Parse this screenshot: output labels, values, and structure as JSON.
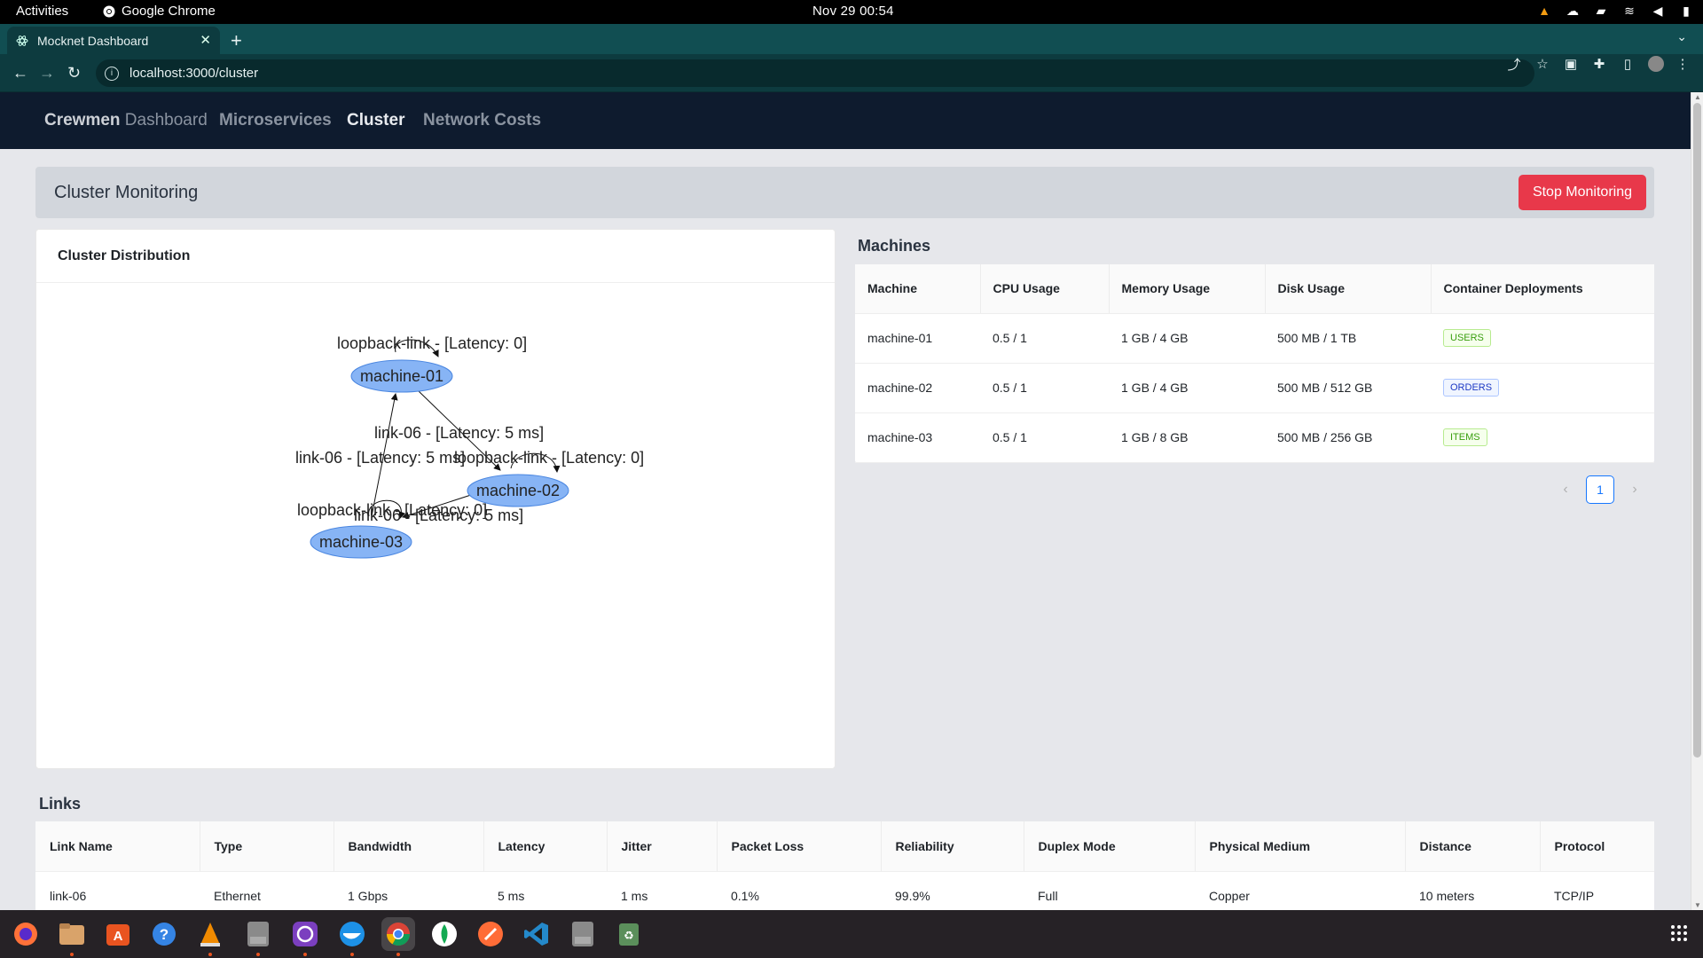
{
  "system_bar": {
    "activities": "Activities",
    "app_name": "Google Chrome",
    "clock": "Nov 29  00:54"
  },
  "browser": {
    "tab_title": "Mocknet Dashboard",
    "url": "localhost:3000/cluster"
  },
  "app_nav": {
    "brand_bold": "Crewmen",
    "brand_rest": " Dashboard",
    "links": [
      "Microservices",
      "Cluster",
      "Network Costs"
    ],
    "active": "Cluster"
  },
  "header": {
    "title": "Cluster Monitoring",
    "stop_button": "Stop Monitoring"
  },
  "distribution": {
    "title": "Cluster Distribution",
    "nodes": [
      "machine-01",
      "machine-02",
      "machine-03"
    ],
    "edge_labels": [
      "loopback-link - [Latency: 0]",
      "link-06 - [Latency: 5 ms]",
      "link-06 - [Latency: 5 ms]",
      "loopback-link - [Latency: 0]",
      "loopback-link - [Latency: 0]",
      "link-06 - [Latency: 5 ms]"
    ]
  },
  "machines": {
    "title": "Machines",
    "columns": [
      "Machine",
      "CPU Usage",
      "Memory Usage",
      "Disk Usage",
      "Container Deployments"
    ],
    "rows": [
      {
        "machine": "machine-01",
        "cpu": "0.5 / 1",
        "memory": "1 GB / 4 GB",
        "disk": "500 MB / 1 TB",
        "deployment": "USERS",
        "tag_color": "#389e0d"
      },
      {
        "machine": "machine-02",
        "cpu": "0.5 / 1",
        "memory": "1 GB / 4 GB",
        "disk": "500 MB / 512 GB",
        "deployment": "ORDERS",
        "tag_color": "#1d39c4"
      },
      {
        "machine": "machine-03",
        "cpu": "0.5 / 1",
        "memory": "1 GB / 8 GB",
        "disk": "500 MB / 256 GB",
        "deployment": "ITEMS",
        "tag_color": "#389e0d"
      }
    ],
    "current_page": "1"
  },
  "links": {
    "title": "Links",
    "columns": [
      "Link Name",
      "Type",
      "Bandwidth",
      "Latency",
      "Jitter",
      "Packet Loss",
      "Reliability",
      "Duplex Mode",
      "Physical Medium",
      "Distance",
      "Protocol"
    ],
    "rows": [
      [
        "link-06",
        "Ethernet",
        "1 Gbps",
        "5 ms",
        "1 ms",
        "0.1%",
        "99.9%",
        "Full",
        "Copper",
        "10 meters",
        "TCP/IP"
      ]
    ]
  },
  "dock": {
    "apps": [
      "firefox-icon",
      "files-icon",
      "app-center-icon",
      "help-icon",
      "vlc-icon",
      "disk-icon",
      "github-desktop-icon",
      "docker-icon",
      "chrome-icon",
      "mongodb-compass-icon",
      "postman-icon",
      "vscode-icon",
      "disk-icon-2",
      "trash-icon"
    ]
  }
}
